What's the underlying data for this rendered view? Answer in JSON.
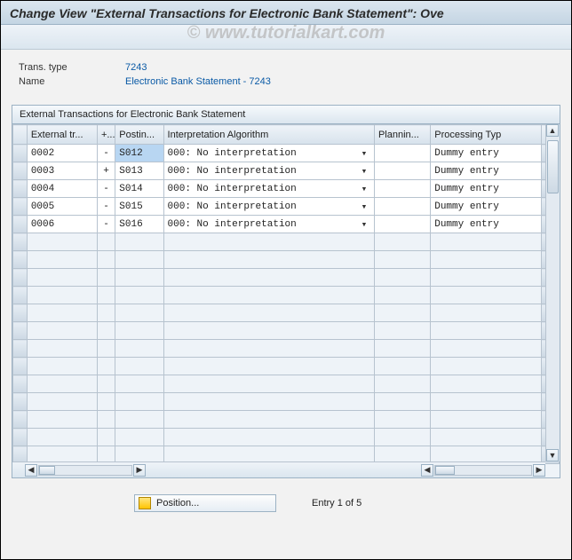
{
  "header": {
    "title": "Change View \"External Transactions for Electronic Bank Statement\": Ove"
  },
  "watermark": "© www.tutorialkart.com",
  "info": {
    "trans_type_label": "Trans. type",
    "trans_type_value": "7243",
    "name_label": "Name",
    "name_value": "Electronic Bank Statement - 7243"
  },
  "grid": {
    "title": "External Transactions for Electronic Bank Statement",
    "columns": {
      "ext": "External tr...",
      "pm": "+...",
      "post": "Postin...",
      "int": "Interpretation Algorithm",
      "plan": "Plannin...",
      "proc": "Processing Typ"
    },
    "rows": [
      {
        "ext": "0002",
        "pm": "-",
        "post": "S012",
        "int": "000: No interpretation",
        "plan": "",
        "proc": "Dummy entry",
        "hl_post": true
      },
      {
        "ext": "0003",
        "pm": "+",
        "post": "S013",
        "int": "000: No interpretation",
        "plan": "",
        "proc": "Dummy entry"
      },
      {
        "ext": "0004",
        "pm": "-",
        "post": "S014",
        "int": "000: No interpretation",
        "plan": "",
        "proc": "Dummy entry"
      },
      {
        "ext": "0005",
        "pm": "-",
        "post": "S015",
        "int": "000: No interpretation",
        "plan": "",
        "proc": "Dummy entry"
      },
      {
        "ext": "0006",
        "pm": "-",
        "post": "S016",
        "int": "000: No interpretation",
        "plan": "",
        "proc": "Dummy entry"
      }
    ],
    "empty_rows": 13
  },
  "footer": {
    "position_label": "Position...",
    "entry_text": "Entry 1 of 5"
  }
}
